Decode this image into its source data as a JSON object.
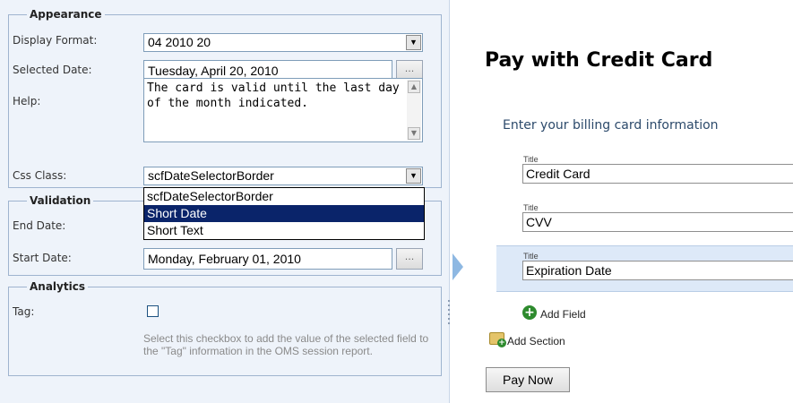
{
  "appearance": {
    "legend": "Appearance",
    "display_format_label": "Display Format:",
    "display_format_value": "04 2010 20",
    "selected_date_label": "Selected Date:",
    "selected_date_value": "Tuesday, April 20, 2010",
    "ellipsis_label": "...",
    "help_label": "Help:",
    "help_value": "The card is valid until the last day of the month indicated.",
    "css_class_label": "Css Class:",
    "css_class_value": "scfDateSelectorBorder",
    "css_class_options": [
      "scfDateSelectorBorder",
      "Short Date",
      "Short Text"
    ],
    "css_class_highlighted_index": 1
  },
  "validation": {
    "legend": "Validation",
    "end_date_label": "End Date:",
    "start_date_label": "Start Date:",
    "start_date_value": "Monday, February 01, 2010",
    "ellipsis_label": "..."
  },
  "analytics": {
    "legend": "Analytics",
    "tag_label": "Tag:",
    "tag_checked": false,
    "help_text": "Select this checkbox to add the value of the selected field to the \"Tag\" information in the OMS session report."
  },
  "form": {
    "title": "Pay with Credit Card",
    "subtitle": "Enter your billing card information",
    "fields": [
      {
        "caption": "Title",
        "value": "Credit Card"
      },
      {
        "caption": "Title",
        "value": "CVV"
      },
      {
        "caption": "Title",
        "value": "Expiration Date"
      }
    ],
    "add_field_label": "Add Field",
    "add_section_label": "Add Section",
    "submit_label": "Pay Now"
  },
  "colors": {
    "panel_background": "#eef3fa",
    "dropdown_highlight": "#0a246a",
    "selected_field_band": "#dde9f8",
    "add_icon_green": "#2e8b2e"
  }
}
